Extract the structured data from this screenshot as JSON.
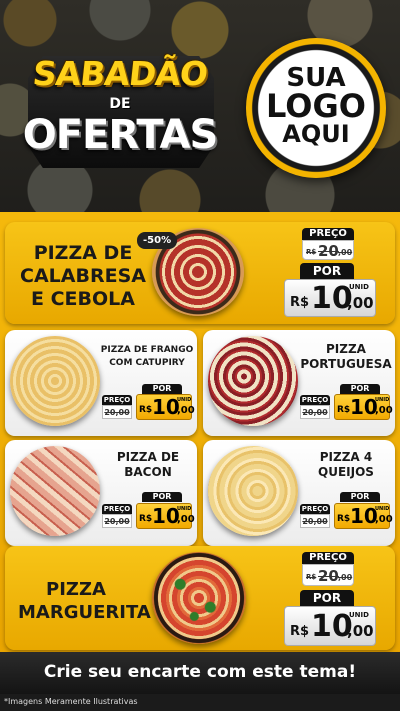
{
  "header": {
    "title_line1": "SABADÃO",
    "title_line2": "DE",
    "title_line3": "OFERTAS",
    "logo": [
      "SUA",
      "LOGO",
      "AQUI"
    ]
  },
  "labels": {
    "preco": "PREÇO",
    "por": "POR",
    "currency": "R$",
    "unid": "UNID"
  },
  "products": {
    "calabresa": {
      "name": [
        "PIZZA DE",
        "CALABRESA",
        "E CEBOLA"
      ],
      "badge": "-50%",
      "old_int": "20",
      "old_dec": ",00",
      "new_int": "10",
      "new_dec": ",00"
    },
    "frango": {
      "name": [
        "PIZZA DE FRANGO",
        "COM CATUPIRY"
      ],
      "old": "20,00",
      "new_int": "10",
      "new_dec": ",00"
    },
    "portuguesa": {
      "name": [
        "PIZZA",
        "PORTUGUESA"
      ],
      "old": "20,00",
      "new_int": "10",
      "new_dec": ",00"
    },
    "bacon": {
      "name": [
        "PIZZA DE",
        "BACON"
      ],
      "old": "20,00",
      "new_int": "10",
      "new_dec": ",00"
    },
    "queijos": {
      "name": [
        "PIZZA 4",
        "QUEIJOS"
      ],
      "old": "20,00",
      "new_int": "10",
      "new_dec": ",00"
    },
    "marguerita": {
      "name": [
        "PIZZA",
        "MARGUERITA"
      ],
      "old_int": "20",
      "old_dec": ",00",
      "new_int": "10",
      "new_dec": ",00"
    }
  },
  "footer": {
    "cta": "Crie seu encarte com este tema!",
    "note": "*Imagens Meramente Ilustrativas"
  }
}
